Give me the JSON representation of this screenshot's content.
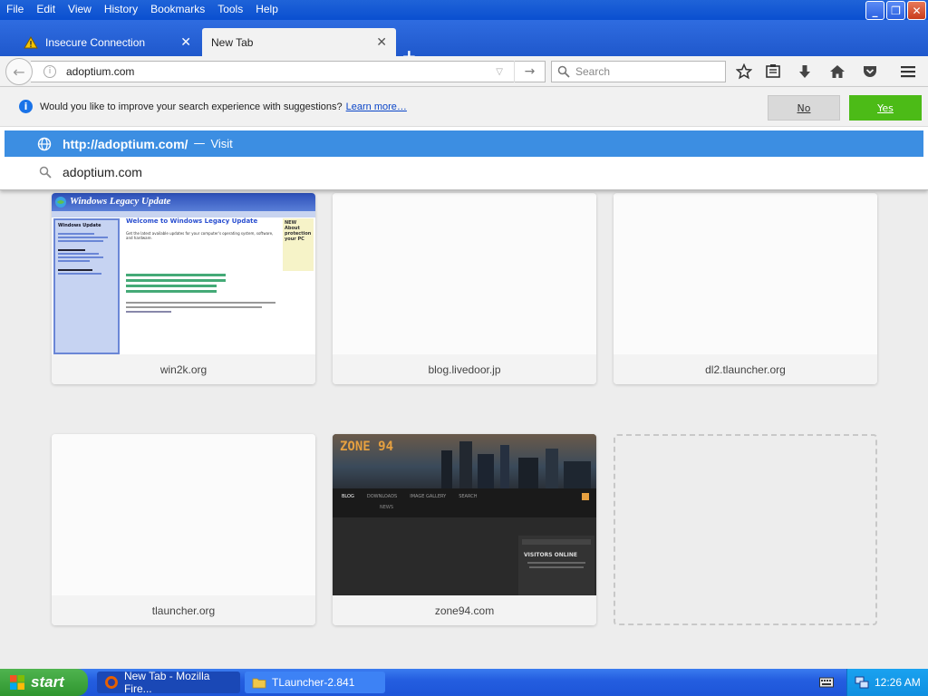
{
  "menu": [
    "File",
    "Edit",
    "View",
    "History",
    "Bookmarks",
    "Tools",
    "Help"
  ],
  "window_controls": {
    "minimize": "_",
    "maximize": "❐",
    "close": "✕"
  },
  "tabs": [
    {
      "label": "Insecure Connection",
      "icon": "warning-icon"
    },
    {
      "label": "New Tab"
    }
  ],
  "new_tab": "+",
  "navbar": {
    "url": "adoptium.com",
    "search_placeholder": "Search"
  },
  "suggestion_prompt": {
    "text": "Would you like to improve your search experience with suggestions?",
    "learn_more": "Learn more…",
    "no": "No",
    "yes": "Yes"
  },
  "autocomplete": {
    "visit_url": "http://adoptium.com/",
    "separator": "—",
    "visit_action": "Visit",
    "search_text": "adoptium.com"
  },
  "tiles": [
    {
      "caption": "win2k.org",
      "thumb": "windows-legacy-update"
    },
    {
      "caption": "blog.livedoor.jp",
      "thumb": "blank"
    },
    {
      "caption": "dl2.tlauncher.org",
      "thumb": "blank"
    },
    {
      "caption": "tlauncher.org",
      "thumb": "blank"
    },
    {
      "caption": "zone94.com",
      "thumb": "zone94"
    },
    {
      "caption": "",
      "thumb": "empty"
    }
  ],
  "win2k_thumb": {
    "banner": "Windows Legacy Update",
    "heading": "Welcome to Windows Legacy Update",
    "sidebar_title": "Windows Update",
    "side_box": "NEW About protection your PC",
    "body": "Get the latest available updates for your computer's operating system, software, and hardware."
  },
  "zone94_thumb": {
    "logo": "ZONE 94",
    "nav": [
      "BLOG",
      "DOWNLOADS",
      "IMAGE GALLERY",
      "SEARCH",
      "NEWS"
    ],
    "visitors": "VISITORS ONLINE"
  },
  "taskbar": {
    "start": "start",
    "tasks": [
      "New Tab - Mozilla Fire...",
      "TLauncher-2.841"
    ],
    "clock": "12:26 AM"
  },
  "colors": {
    "xp_blue": "#245ee0",
    "highlight": "#3c8ee2",
    "yes_green": "#4cbb17",
    "start_green": "#2f962f"
  }
}
